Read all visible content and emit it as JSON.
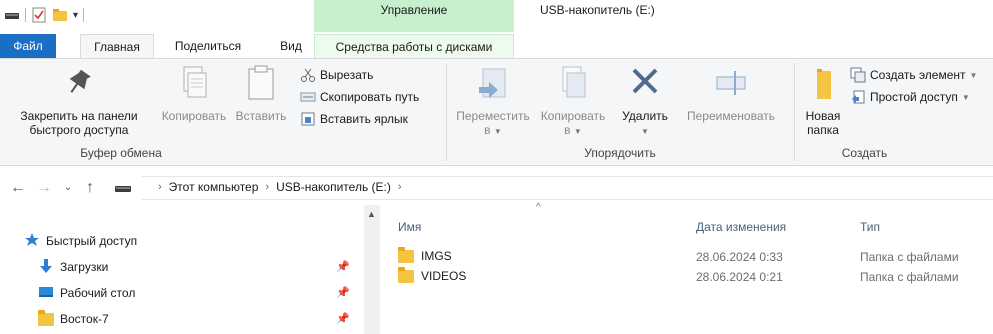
{
  "titlebar": {
    "context_label": "Управление",
    "title": "USB-накопитель (E:)",
    "qat_dropdown": "▾"
  },
  "tabs": {
    "file": "Файл",
    "home": "Главная",
    "share": "Поделиться",
    "view": "Вид",
    "disk_tools": "Средства работы с дисками"
  },
  "ribbon": {
    "clipboard": {
      "pin_label_1": "Закрепить на панели",
      "pin_label_2": "быстрого доступа",
      "copy": "Копировать",
      "paste": "Вставить",
      "cut": "Вырезать",
      "copy_path": "Скопировать путь",
      "paste_shortcut": "Вставить ярлык",
      "group_label": "Буфер обмена"
    },
    "organize": {
      "move_1": "Переместить",
      "move_2": "в",
      "copy_1": "Копировать",
      "copy_2": "в",
      "delete": "Удалить",
      "rename": "Переименовать",
      "group_label": "Упорядочить"
    },
    "create": {
      "new_folder_1": "Новая",
      "new_folder_2": "папка",
      "new_item": "Создать элемент",
      "easy_access": "Простой доступ",
      "group_label": "Создать"
    }
  },
  "address": {
    "crumbs": [
      "Этот компьютер",
      "USB-накопитель (E:)"
    ]
  },
  "navpane": {
    "items": [
      {
        "label": "Быстрый доступ",
        "icon": "star-icon"
      },
      {
        "label": "Загрузки",
        "icon": "download-icon"
      },
      {
        "label": "Рабочий стол",
        "icon": "desktop-icon"
      },
      {
        "label": "Восток-7",
        "icon": "folder-icon"
      }
    ]
  },
  "content": {
    "columns": {
      "name": "Имя",
      "date": "Дата изменения",
      "type": "Тип"
    },
    "rows": [
      {
        "name": "IMGS",
        "date": "28.06.2024 0:33",
        "type": "Папка с файлами"
      },
      {
        "name": "VIDEOS",
        "date": "28.06.2024 0:21",
        "type": "Папка с файлами"
      }
    ]
  },
  "colors": {
    "accent": "#1a6fc4",
    "context_tab": "#c6efce",
    "folder": "#f5c342"
  }
}
